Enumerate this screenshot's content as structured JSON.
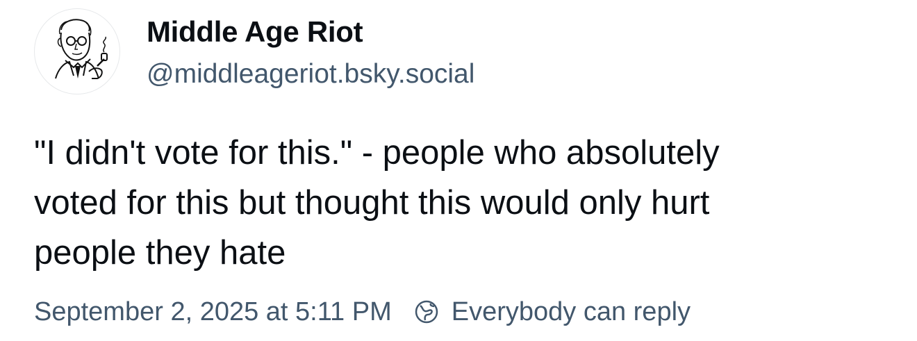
{
  "author": {
    "display_name": "Middle Age Riot",
    "handle": "@middleageriot.bsky.social",
    "avatar_icon": "vintage-man-with-pipe-illustration"
  },
  "post": {
    "text_lines": [
      "\"I didn't vote for this.\" - people who absolutely",
      "voted for this but thought this would only hurt",
      "people they hate"
    ]
  },
  "meta": {
    "timestamp": "September 2, 2025 at 5:11 PM",
    "reply_setting_label": "Everybody can reply",
    "reply_icon": "globe-icon"
  },
  "colors": {
    "primary_text": "#0b0f14",
    "secondary_text": "#42576c"
  }
}
